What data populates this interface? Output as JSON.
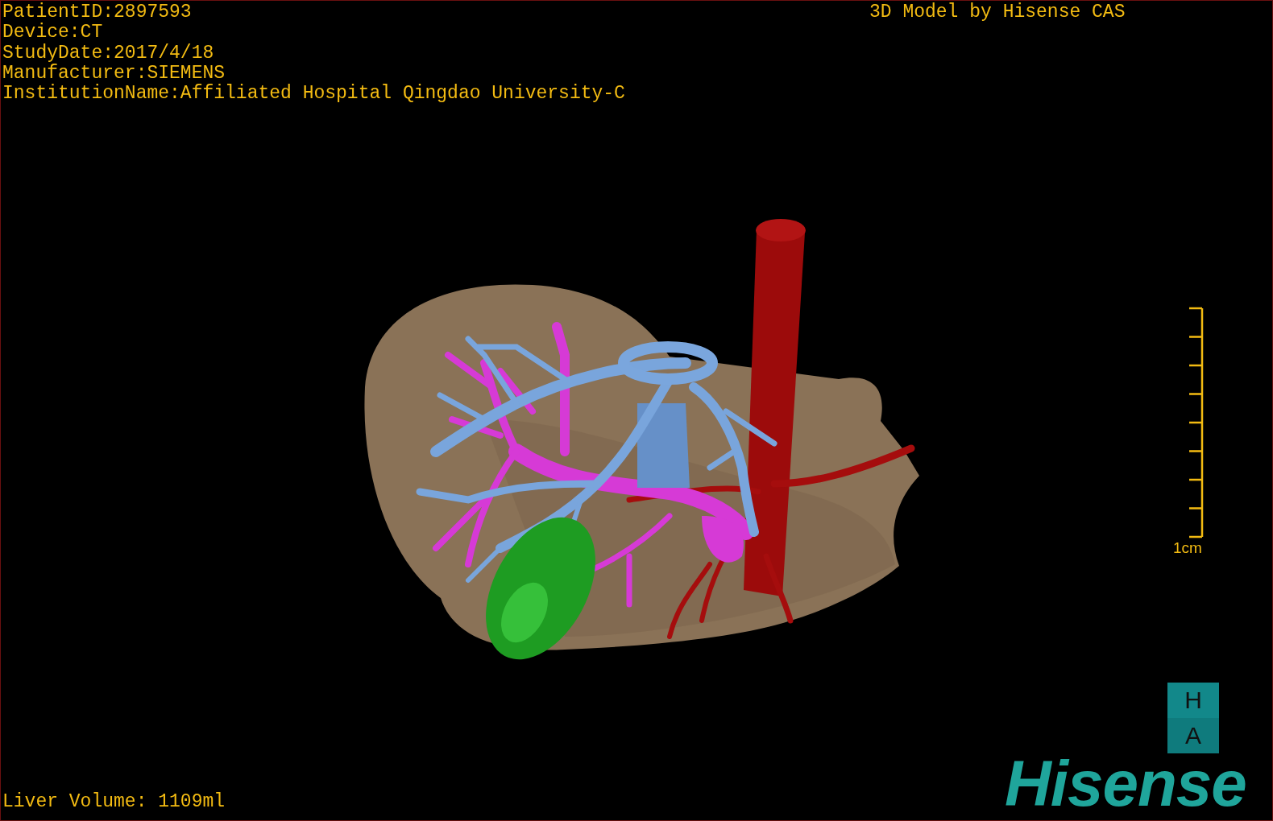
{
  "study_info": [
    "PatientID:2897593",
    "Device:CT",
    "StudyDate:2017/4/18",
    "Manufacturer:SIEMENS",
    "InstitutionName:Affiliated Hospital Qingdao University-C"
  ],
  "title": "3D Model by Hisense CAS",
  "scale_bar": {
    "label": "1cm"
  },
  "orientation_cube": {
    "top": "H",
    "bottom": "A"
  },
  "logo": "Hisense",
  "liver_volume": "Liver Volume: 1109ml"
}
